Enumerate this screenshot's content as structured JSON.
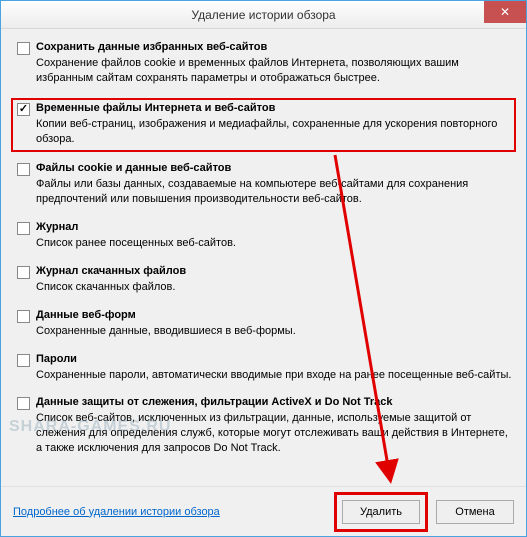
{
  "window": {
    "title": "Удаление истории обзора",
    "close_glyph": "✕"
  },
  "options": [
    {
      "id": "preserve-favorites",
      "checked": false,
      "highlight": false,
      "label": "Сохранить данные избранных веб-сайтов",
      "desc": "Сохранение файлов cookie и временных файлов Интернета, позволяющих вашим избранным сайтам сохранять параметры и отображаться быстрее."
    },
    {
      "id": "temp-internet-files",
      "checked": true,
      "highlight": true,
      "label": "Временные файлы Интернета и веб-сайтов",
      "desc": "Копии веб-страниц, изображения и медиафайлы, сохраненные для ускорения повторного обзора."
    },
    {
      "id": "cookies",
      "checked": false,
      "highlight": false,
      "label": "Файлы cookie и данные веб-сайтов",
      "desc": "Файлы или базы данных, создаваемые на компьютере веб-сайтами для сохранения предпочтений или повышения производительности веб-сайтов."
    },
    {
      "id": "history",
      "checked": false,
      "highlight": false,
      "label": "Журнал",
      "desc": "Список ранее посещенных веб-сайтов."
    },
    {
      "id": "download-history",
      "checked": false,
      "highlight": false,
      "label": "Журнал скачанных файлов",
      "desc": "Список скачанных файлов."
    },
    {
      "id": "form-data",
      "checked": false,
      "highlight": false,
      "label": "Данные веб-форм",
      "desc": "Сохраненные данные, вводившиеся в веб-формы."
    },
    {
      "id": "passwords",
      "checked": false,
      "highlight": false,
      "label": "Пароли",
      "desc": "Сохраненные пароли, автоматически вводимые при входе на ранее посещенные веб-сайты."
    },
    {
      "id": "tracking-protection",
      "checked": false,
      "highlight": false,
      "label": "Данные защиты от слежения, фильтрации ActiveX и Do Not Track",
      "desc": "Список веб-сайтов, исключенных из фильтрации, данные, используемые защитой от слежения для определения служб, которые могут отслеживать ваши действия в Интернете, а также исключения для запросов Do Not Track."
    }
  ],
  "footer": {
    "link": "Подробнее об удалении истории обзора",
    "delete_label": "Удалить",
    "cancel_label": "Отмена"
  },
  "watermark": "SHARA-GAMES.RU",
  "annotation": {
    "arrow_color": "#e10000"
  }
}
